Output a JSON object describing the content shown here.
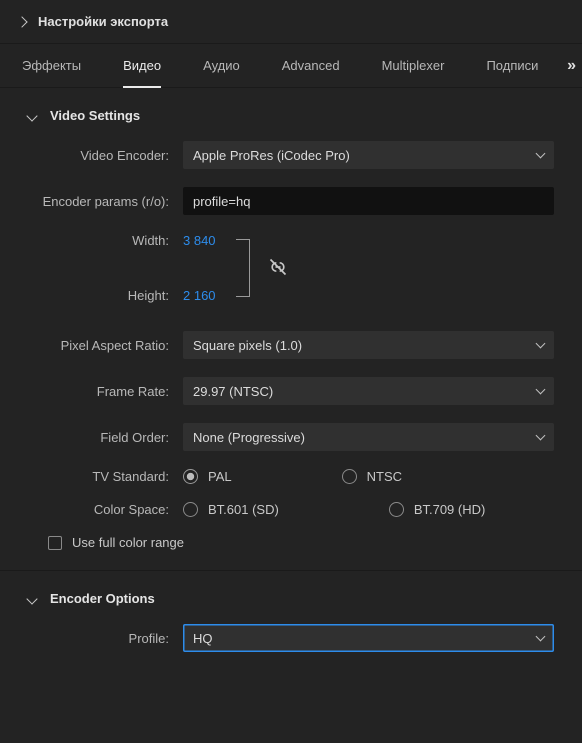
{
  "header": {
    "title": "Настройки экспорта"
  },
  "tabs": {
    "items": [
      {
        "label": "Эффекты"
      },
      {
        "label": "Видео"
      },
      {
        "label": "Аудио"
      },
      {
        "label": "Advanced"
      },
      {
        "label": "Multiplexer"
      },
      {
        "label": "Подписи"
      }
    ],
    "active_index": 1
  },
  "video_settings": {
    "title": "Video Settings",
    "encoder_label": "Video Encoder:",
    "encoder_value": "Apple ProRes (iCodec Pro)",
    "params_label": "Encoder params (r/o):",
    "params_value": "profile=hq",
    "width_label": "Width:",
    "width_value": "3 840",
    "height_label": "Height:",
    "height_value": "2 160",
    "par_label": "Pixel Aspect Ratio:",
    "par_value": "Square pixels (1.0)",
    "fps_label": "Frame Rate:",
    "fps_value": "29.97 (NTSC)",
    "field_label": "Field Order:",
    "field_value": "None (Progressive)",
    "tvstd_label": "TV Standard:",
    "tvstd_options": {
      "pal": "PAL",
      "ntsc": "NTSC"
    },
    "tvstd_selected": "pal",
    "cspace_label": "Color Space:",
    "cspace_options": {
      "bt601": "BT.601 (SD)",
      "bt709": "BT.709 (HD)"
    },
    "cspace_selected": null,
    "fullrange_label": "Use full color range",
    "fullrange_checked": false
  },
  "encoder_options": {
    "title": "Encoder Options",
    "profile_label": "Profile:",
    "profile_value": "HQ"
  }
}
